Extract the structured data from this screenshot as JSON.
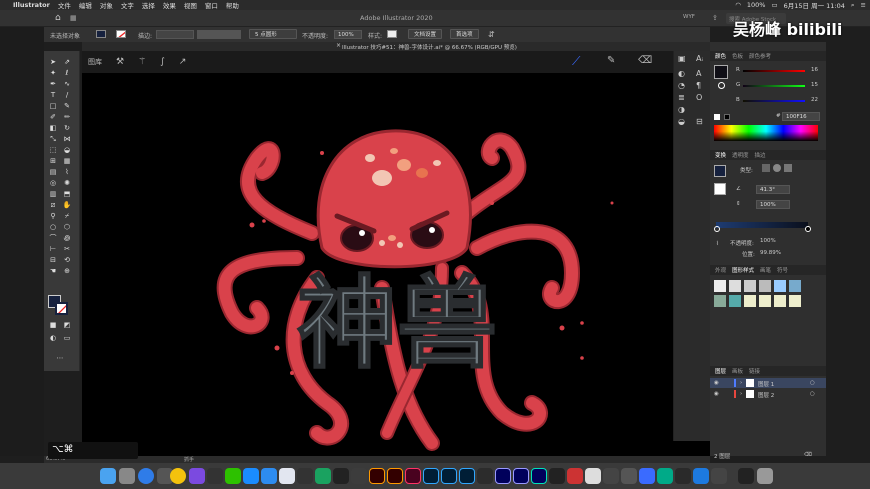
{
  "menubar": {
    "app_name": "Illustrator",
    "items": [
      "文件",
      "编辑",
      "对象",
      "文字",
      "选择",
      "效果",
      "视图",
      "窗口",
      "帮助"
    ],
    "battery": "100%",
    "datetime": "6月15日 周一 11:04"
  },
  "appbar": {
    "title": "Adobe Illustrator 2020",
    "workspace": "WYF",
    "search_placeholder": "搜索 Adobe Stock"
  },
  "control": {
    "selection_label": "未选择对象",
    "stroke_label": "描边:",
    "brush_label": "5 点圆形",
    "opacity_label": "不透明度:",
    "opacity_value": "100%",
    "style_label": "样式:",
    "doc_setup": "文档设置",
    "preferences": "首选项"
  },
  "document": {
    "tab_title": "Illustrator 技巧#51：神兽-字体设计.ai* @ 66.67% (RGB/GPU 预览)",
    "strip_label": "图库"
  },
  "artwork": {
    "title_text": "神兽"
  },
  "color_panel": {
    "tabs": [
      "颜色",
      "色板",
      "颜色参考"
    ],
    "r_label": "R",
    "r_value": "16",
    "g_label": "G",
    "g_value": "15",
    "b_label": "B",
    "b_value": "22",
    "hex_value": "100F16",
    "hex_symbol": "#"
  },
  "transform_panel": {
    "tabs": [
      "变换",
      "透明度",
      "描边"
    ],
    "type_label": "类型:",
    "angle_value": "41.3°",
    "scale_value": "100%",
    "opacity_label": "不透明度:",
    "opacity_value": "100%",
    "position_label": "位置:",
    "position_value": "99.89%"
  },
  "graphic_styles": {
    "tabs": [
      "外观",
      "图形样式",
      "画笔",
      "符号"
    ]
  },
  "layers_panel": {
    "tabs": [
      "图层",
      "画板",
      "链接"
    ],
    "layers": [
      {
        "name": "图层 1",
        "color": "#4f7cff"
      },
      {
        "name": "图层 2",
        "color": "#e8473f"
      }
    ],
    "footer": "2 图层"
  },
  "status": {
    "zoom": "66.67%",
    "tool_name": "抓手"
  },
  "overlay": {
    "watermark": "吴杨峰 bilibili",
    "shortcut": "⌥⌘"
  },
  "colors": {
    "octopus_body": "#d9424b",
    "octopus_dark": "#9a2730",
    "text_gray": "#6f7a80",
    "accent_blue": "#3a6bff"
  }
}
